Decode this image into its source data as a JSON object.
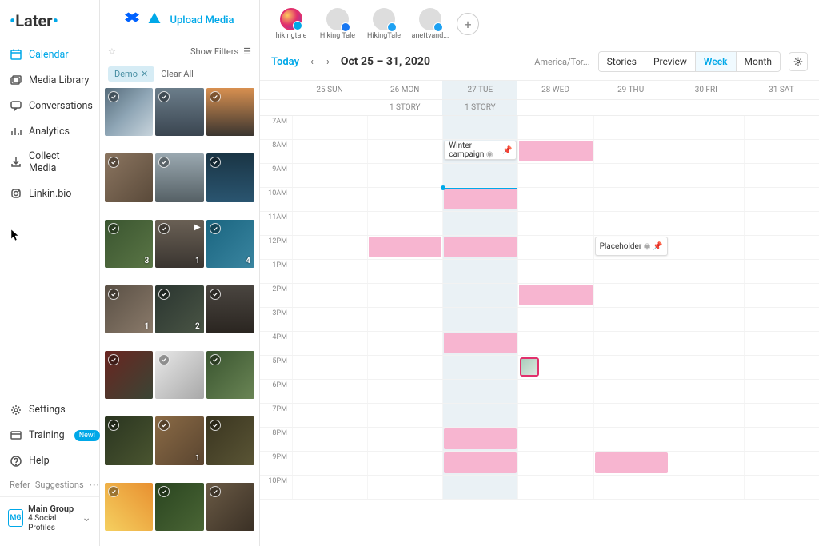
{
  "logo": "Later",
  "nav": [
    {
      "label": "Calendar",
      "icon": "calendar"
    },
    {
      "label": "Media Library",
      "icon": "media"
    },
    {
      "label": "Conversations",
      "icon": "chat"
    },
    {
      "label": "Analytics",
      "icon": "analytics"
    },
    {
      "label": "Collect Media",
      "icon": "collect"
    },
    {
      "label": "Linkin.bio",
      "icon": "linkinbio"
    }
  ],
  "nav_bottom": [
    {
      "label": "Settings"
    },
    {
      "label": "Training",
      "badge": "New!"
    },
    {
      "label": "Help"
    }
  ],
  "refer": {
    "label": "Refer",
    "suggestions": "Suggestions"
  },
  "group": {
    "badge": "MG",
    "title": "Main Group",
    "subtitle": "4 Social Profiles"
  },
  "upload": {
    "label": "Upload Media"
  },
  "filters": {
    "label": "Show Filters"
  },
  "tags": {
    "demo": "Demo",
    "clear": "Clear All"
  },
  "media_thumbs": [
    {
      "bg": "linear-gradient(135deg,#556b7a,#8ea5b5,#c8d4dc)"
    },
    {
      "bg": "linear-gradient(180deg,#6b7d8a,#3a4550)"
    },
    {
      "bg": "linear-gradient(180deg,#d89050,#3a3530)"
    },
    {
      "bg": "linear-gradient(135deg,#8b7560,#5a4a3a)"
    },
    {
      "bg": "linear-gradient(180deg,#9aa8b0,#556065)"
    },
    {
      "bg": "linear-gradient(180deg,#1a3545,#2a5570)"
    },
    {
      "bg": "linear-gradient(135deg,#3a5530,#5a7545)",
      "count": "3"
    },
    {
      "bg": "linear-gradient(180deg,#6a6055,#3a3530)",
      "count": "1",
      "play": true
    },
    {
      "bg": "linear-gradient(135deg,#1a6580,#3a85a0)",
      "count": "4"
    },
    {
      "bg": "linear-gradient(135deg,#5a5045,#8a7a6a)",
      "count": "1"
    },
    {
      "bg": "linear-gradient(135deg,#2a3530,#4a5545)",
      "count": "2"
    },
    {
      "bg": "linear-gradient(180deg,#4a4540,#2a2520)"
    },
    {
      "bg": "linear-gradient(135deg,#6a2520,#3a4535)"
    },
    {
      "bg": "linear-gradient(135deg,#e8e8e8,#a8a8a8)"
    },
    {
      "bg": "linear-gradient(135deg,#3a5530,#6a8555)"
    },
    {
      "bg": "linear-gradient(135deg,#2a3520,#4a5530)"
    },
    {
      "bg": "linear-gradient(135deg,#8a6a45,#5a4530)",
      "count": "1"
    },
    {
      "bg": "linear-gradient(135deg,#3a3520,#5a5535)"
    },
    {
      "bg": "linear-gradient(45deg,#f5d060,#e89030)"
    },
    {
      "bg": "linear-gradient(135deg,#2a4520,#4a6535)"
    },
    {
      "bg": "linear-gradient(135deg,#6a5a45,#3a3025)"
    }
  ],
  "profiles": [
    {
      "name": "hikingtale",
      "type": "ig"
    },
    {
      "name": "Hiking Tale",
      "type": "fb"
    },
    {
      "name": "HikingTale",
      "type": "tw"
    },
    {
      "name": "anettvand...",
      "type": "pin"
    }
  ],
  "toolbar": {
    "today": "Today",
    "date_range": "Oct 25 – 31, 2020",
    "timezone": "America/Tor...",
    "views": [
      "Stories",
      "Preview",
      "Week",
      "Month"
    ]
  },
  "days": [
    {
      "label": "25 SUN"
    },
    {
      "label": "26 MON",
      "story": "1 STORY"
    },
    {
      "label": "27 TUE",
      "story": "1 STORY",
      "highlight": true
    },
    {
      "label": "28 WED"
    },
    {
      "label": "29 THU"
    },
    {
      "label": "30 FRI"
    },
    {
      "label": "31 SAT"
    }
  ],
  "hours": [
    "7AM",
    "8AM",
    "9AM",
    "10AM",
    "11AM",
    "12PM",
    "1PM",
    "2PM",
    "3PM",
    "4PM",
    "5PM",
    "6PM",
    "7PM",
    "8PM",
    "9PM",
    "10PM"
  ],
  "events": {
    "winter_campaign": "Winter campaign",
    "placeholder": "Placeholder"
  },
  "colors": {
    "accent": "#00a8e8",
    "pink": "#f7b5d0"
  }
}
